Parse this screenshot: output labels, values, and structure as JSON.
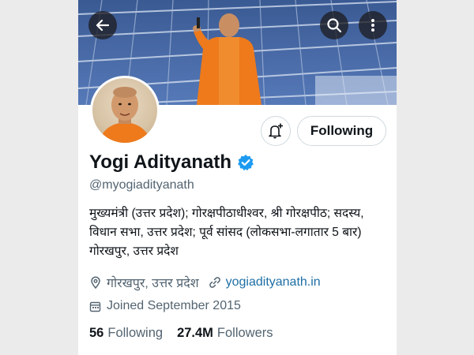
{
  "profile": {
    "name": "Yogi Adityanath",
    "handle": "@myogiadityanath",
    "verified": true,
    "bio_lines": [
      "मुख्यमंत्री (उत्तर प्रदेश); गोरक्षपीठाधीश्वर, श्री गोरक्षपीठ; सदस्य,",
      "विधान सभा, उत्तर प्रदेश; पूर्व सांसद (लोकसभा-लगातार 5 बार)",
      "गोरखपुर, उत्तर प्रदेश"
    ],
    "location": "गोरखपुर, उत्तर प्रदेश",
    "website": "yogiadityanath.in",
    "joined": "Joined September 2015",
    "following_count": "56",
    "following_label": "Following",
    "followers_count": "27.4M",
    "followers_label": "Followers"
  },
  "actions": {
    "follow_state_label": "Following"
  },
  "icons": {
    "back": "back-arrow-icon",
    "search": "search-icon",
    "more": "more-vertical-icon",
    "notify": "bell-plus-icon",
    "verified": "verified-badge-icon",
    "location": "location-pin-icon",
    "link": "link-icon",
    "calendar": "calendar-icon"
  },
  "colors": {
    "accent": "#1d9bf0",
    "link": "#1d6fa5",
    "text": "#0f1419",
    "muted": "#536471"
  }
}
